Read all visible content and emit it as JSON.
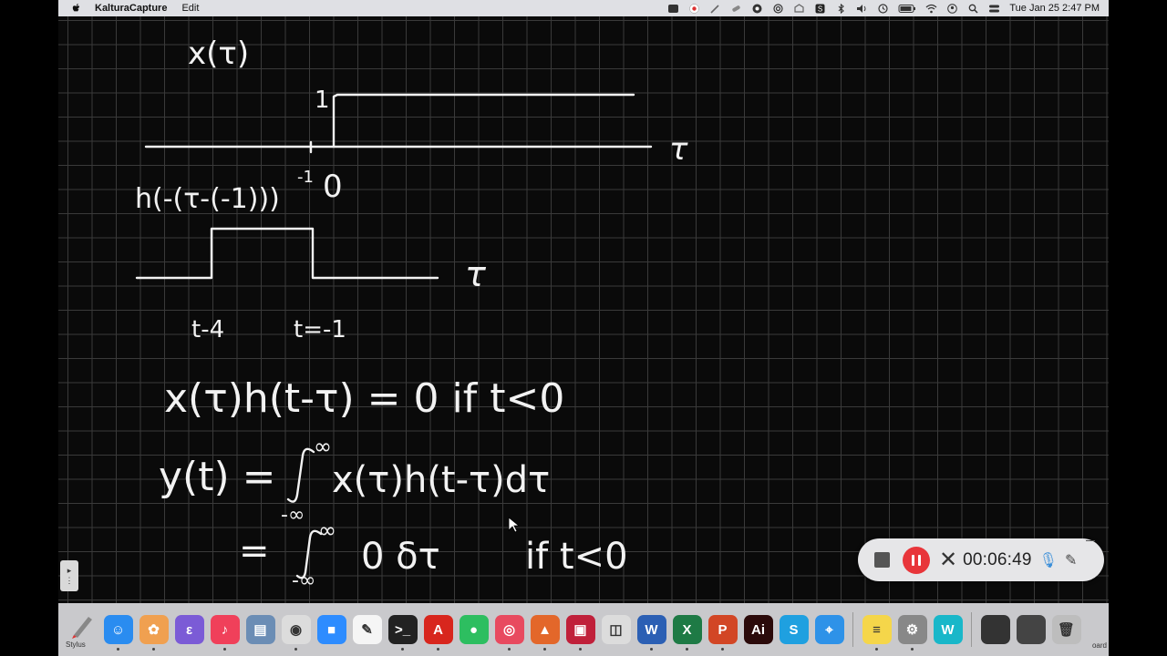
{
  "menubar": {
    "app_name": "KalturaCapture",
    "menu_edit": "Edit",
    "datetime": "Tue Jan 25  2:47 PM",
    "icons": [
      "status-icon",
      "flag-icon",
      "pen-icon",
      "bandage-icon",
      "camera-icon",
      "airdrop-icon",
      "upload-icon",
      "s-icon",
      "bluetooth-icon",
      "volume-icon",
      "time-machine-icon",
      "battery-icon",
      "wifi-icon",
      "user-icon",
      "search-icon",
      "control-center-icon"
    ]
  },
  "whiteboard": {
    "x_label": "x(τ)",
    "tau_axis_1": "τ",
    "one_label": "1",
    "minus_one_label": "-1",
    "zero_label": "0",
    "h_label": "h(-(τ-(-1)))",
    "tau_axis_2": "τ",
    "t_minus4": "t-4",
    "t_minus1": "t=-1",
    "eq1": "x(τ)h(t-τ) = 0   if  t<0",
    "eq2_lhs": "y(t) =",
    "eq2_rhs": "x(τ)h(t-τ)dτ",
    "eq2_upper": "∞",
    "eq2_lower": "-∞",
    "eq3_lhs": "=",
    "eq3_rhs": "0 δτ",
    "eq3_upper": "∞",
    "eq3_lower": "-∞",
    "eq3_cond": "if  t<0"
  },
  "side_tab": {
    "label": "▸"
  },
  "recorder": {
    "time": "00:06:49",
    "colors": {
      "pause": "#e8353a",
      "mic": "#3b8fd9"
    }
  },
  "dock": {
    "stylus_label": "Stylus",
    "board_label": "oard",
    "items": [
      {
        "name": "finder-icon",
        "color": "#2a8cf0",
        "glyph": "☺"
      },
      {
        "name": "photos-ish-icon",
        "color": "#f0a050",
        "glyph": "✿"
      },
      {
        "name": "emacs-icon",
        "color": "#7b5bd6",
        "glyph": "ε"
      },
      {
        "name": "music-icon",
        "color": "#f0405a",
        "glyph": "♪"
      },
      {
        "name": "preview-icon",
        "color": "#6b8db5",
        "glyph": "▤"
      },
      {
        "name": "chrome-icon",
        "color": "#dcdcdc",
        "glyph": "◉"
      },
      {
        "name": "zoom-icon",
        "color": "#2d8cff",
        "glyph": "■"
      },
      {
        "name": "textedit-icon",
        "color": "#f5f5f5",
        "glyph": "✎"
      },
      {
        "name": "terminal-icon",
        "color": "#222",
        "glyph": ">_"
      },
      {
        "name": "acrobat-icon",
        "color": "#d8261d",
        "glyph": "A"
      },
      {
        "name": "evernote-icon",
        "color": "#2dbe60",
        "glyph": "●"
      },
      {
        "name": "photo-booth-icon",
        "color": "#e84a5f",
        "glyph": "◎"
      },
      {
        "name": "matlab-icon",
        "color": "#e3672a",
        "glyph": "▲"
      },
      {
        "name": "kaltura-icon",
        "color": "#c0203a",
        "glyph": "▣"
      },
      {
        "name": "screenshot-icon",
        "color": "#dcdcdc",
        "glyph": "◫"
      },
      {
        "name": "word-icon",
        "color": "#2b5fb4",
        "glyph": "W"
      },
      {
        "name": "excel-icon",
        "color": "#1e7a45",
        "glyph": "X"
      },
      {
        "name": "powerpoint-icon",
        "color": "#d24625",
        "glyph": "P"
      },
      {
        "name": "illustrator-icon",
        "color": "#2b0a0a",
        "glyph": "Ai"
      },
      {
        "name": "skype-icon",
        "color": "#1fa0e0",
        "glyph": "S"
      },
      {
        "name": "safari-icon",
        "color": "#2e92e8",
        "glyph": "⌖"
      },
      {
        "name": "notes-icon",
        "color": "#f5d64a",
        "glyph": "≡"
      },
      {
        "name": "settings-icon",
        "color": "#888",
        "glyph": "⚙"
      },
      {
        "name": "webex-icon",
        "color": "#19b7c9",
        "glyph": "W"
      },
      {
        "name": "window-1-icon",
        "color": "#333",
        "glyph": ""
      },
      {
        "name": "window-2-icon",
        "color": "#444",
        "glyph": ""
      },
      {
        "name": "trash-icon",
        "color": "#bdbdbd",
        "glyph": "🗑"
      }
    ]
  }
}
